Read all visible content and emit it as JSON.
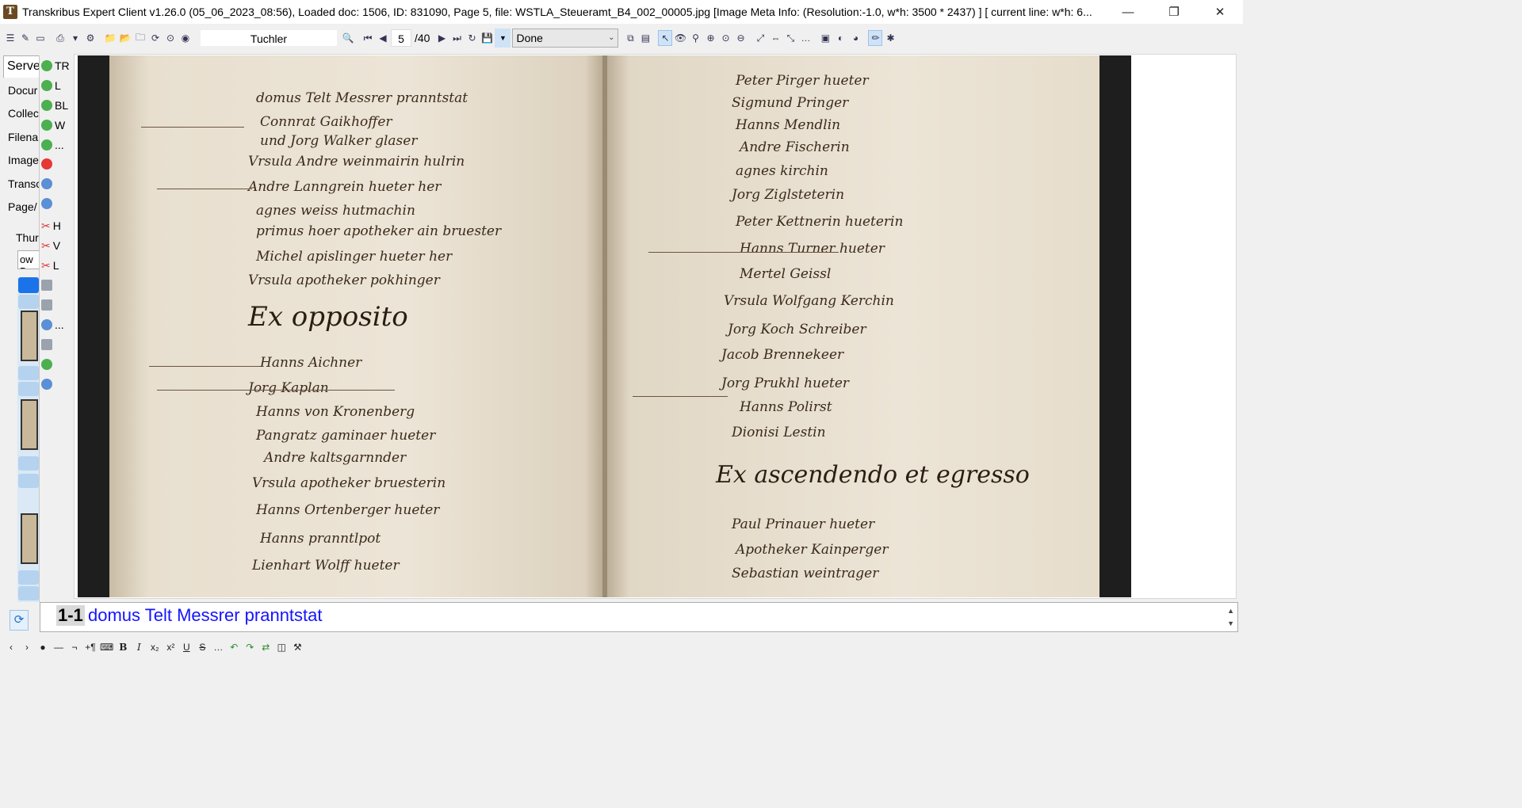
{
  "window": {
    "title": "Transkribus Expert Client v1.26.0 (05_06_2023_08:56), Loaded doc: 1506, ID: 831090, Page 5, file: WSTLA_Steueramt_B4_002_00005.jpg [Image Meta Info: (Resolution:-1.0, w*h: 3500 * 2437) ] [ current line: w*h: 6...",
    "minimize": "—",
    "restore": "❐",
    "close": "✕"
  },
  "toolbar": {
    "collection_filter": "Tuchler",
    "page_number": "5",
    "page_total": "/40",
    "status": "Done"
  },
  "left_panel": {
    "tab": "Serve",
    "rows": [
      "Docur",
      "Collec",
      "Filenai",
      "Image",
      "Transc",
      "Page/"
    ],
    "thumbnails_label": "Thur",
    "view_input": "ow D"
  },
  "tools": [
    "TR",
    "L",
    "BL",
    "W",
    "...",
    "H",
    "V",
    "L",
    "..."
  ],
  "manuscript": {
    "left_page_lines": [
      "domus Telt Messrer pranntstat",
      "Connrat Gaikhoffer",
      "und Jorg Walker glaser",
      "Vrsula Andre weinmairin hulrin",
      "Andre Lanngrein hueter her",
      "agnes weiss hutmachin",
      "primus hoer apotheker ain bruester",
      "Michel apislinger hueter her",
      "Vrsula apotheker pokhinger",
      "Hanns Aichner",
      "Jorg Kaplan",
      "Hanns von Kronenberg",
      "Pangratz gaminaer hueter",
      "Andre kaltsgarnnder",
      "Vrsula apotheker bruesterin",
      "Hanns Ortenberger hueter",
      "Hanns pranntlpot",
      "Lienhart Wolff hueter"
    ],
    "left_heading": "Ex opposito",
    "right_page_lines": [
      "Peter Pirger hueter",
      "Sigmund Pringer",
      "Hanns Mendlin",
      "Andre Fischerin",
      "agnes kirchin",
      "Jorg Ziglsteterin",
      "Peter Kettnerin hueterin",
      "Hanns Turner hueter",
      "Mertel Geissl",
      "Vrsula Wolfgang Kerchin",
      "Jorg Koch Schreiber",
      "Jacob Brennekeer",
      "Jorg Prukhl hueter",
      "Hanns Polirst",
      "Dionisi Lestin",
      "Paul Prinauer hueter",
      "Apotheker Kainperger",
      "Sebastian weintrager"
    ],
    "right_heading": "Ex ascendendo et egresso"
  },
  "transcription": {
    "line_number": "1-1",
    "text": "domus Telt Messrer pranntstat"
  }
}
